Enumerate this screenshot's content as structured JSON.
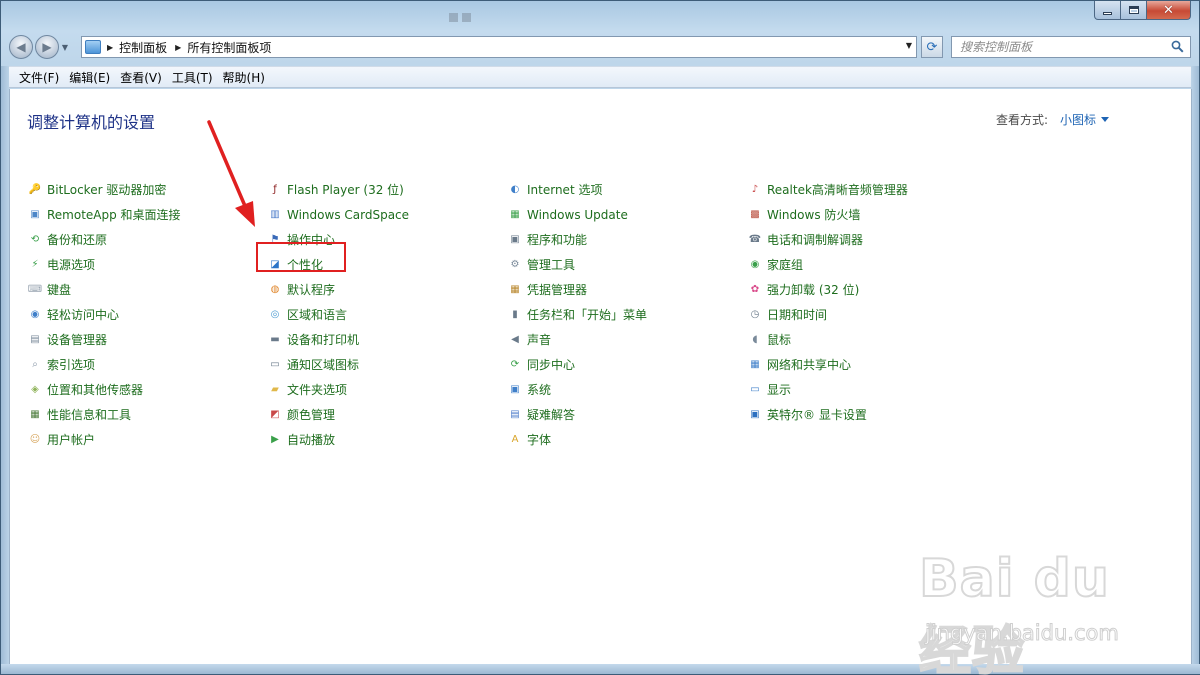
{
  "window": {
    "minimize": "—",
    "maximize": "□",
    "close": "✕"
  },
  "address": {
    "crumbs": [
      "控制面板",
      "所有控制面板项"
    ]
  },
  "search": {
    "placeholder": "搜索控制面板"
  },
  "menu": [
    "文件(F)",
    "编辑(E)",
    "查看(V)",
    "工具(T)",
    "帮助(H)"
  ],
  "content": {
    "heading": "调整计算机的设置",
    "view_by_label": "查看方式:",
    "view_by_value": "小图标"
  },
  "columns": [
    [
      {
        "label": "BitLocker 驱动器加密",
        "icon": "bitlocker-icon"
      },
      {
        "label": "RemoteApp 和桌面连接",
        "icon": "remoteapp-icon"
      },
      {
        "label": "备份和还原",
        "icon": "backup-icon"
      },
      {
        "label": "电源选项",
        "icon": "power-icon"
      },
      {
        "label": "键盘",
        "icon": "keyboard-icon"
      },
      {
        "label": "轻松访问中心",
        "icon": "ease-of-access-icon"
      },
      {
        "label": "设备管理器",
        "icon": "device-manager-icon"
      },
      {
        "label": "索引选项",
        "icon": "indexing-icon"
      },
      {
        "label": "位置和其他传感器",
        "icon": "sensor-icon"
      },
      {
        "label": "性能信息和工具",
        "icon": "performance-icon"
      },
      {
        "label": "用户帐户",
        "icon": "user-accounts-icon"
      }
    ],
    [
      {
        "label": "Flash Player (32 位)",
        "icon": "flash-icon"
      },
      {
        "label": "Windows CardSpace",
        "icon": "cardspace-icon"
      },
      {
        "label": "操作中心",
        "icon": "flag-icon"
      },
      {
        "label": "个性化",
        "icon": "personalization-icon"
      },
      {
        "label": "默认程序",
        "icon": "default-programs-icon"
      },
      {
        "label": "区域和语言",
        "icon": "region-icon"
      },
      {
        "label": "设备和打印机",
        "icon": "printer-icon"
      },
      {
        "label": "通知区域图标",
        "icon": "notification-icon"
      },
      {
        "label": "文件夹选项",
        "icon": "folder-options-icon"
      },
      {
        "label": "颜色管理",
        "icon": "color-management-icon"
      },
      {
        "label": "自动播放",
        "icon": "autoplay-icon"
      }
    ],
    [
      {
        "label": "Internet 选项",
        "icon": "internet-options-icon"
      },
      {
        "label": "Windows Update",
        "icon": "windows-update-icon"
      },
      {
        "label": "程序和功能",
        "icon": "programs-icon"
      },
      {
        "label": "管理工具",
        "icon": "admin-tools-icon"
      },
      {
        "label": "凭据管理器",
        "icon": "credential-icon"
      },
      {
        "label": "任务栏和「开始」菜单",
        "icon": "taskbar-icon"
      },
      {
        "label": "声音",
        "icon": "sound-icon"
      },
      {
        "label": "同步中心",
        "icon": "sync-icon"
      },
      {
        "label": "系统",
        "icon": "system-icon"
      },
      {
        "label": "疑难解答",
        "icon": "troubleshoot-icon"
      },
      {
        "label": "字体",
        "icon": "fonts-icon"
      }
    ],
    [
      {
        "label": "Realtek高清晰音频管理器",
        "icon": "realtek-icon"
      },
      {
        "label": "Windows 防火墙",
        "icon": "firewall-icon"
      },
      {
        "label": "电话和调制解调器",
        "icon": "phone-modem-icon"
      },
      {
        "label": "家庭组",
        "icon": "homegroup-icon"
      },
      {
        "label": "强力卸载 (32 位)",
        "icon": "uninstall-icon"
      },
      {
        "label": "日期和时间",
        "icon": "date-time-icon"
      },
      {
        "label": "鼠标",
        "icon": "mouse-icon"
      },
      {
        "label": "网络和共享中心",
        "icon": "network-icon"
      },
      {
        "label": "显示",
        "icon": "display-icon"
      },
      {
        "label": "英特尔® 显卡设置",
        "icon": "intel-graphics-icon"
      }
    ]
  ],
  "watermark": {
    "brand": "Bai du 经验",
    "url": "jingyan.baidu.com"
  },
  "colors": {
    "link": "#1e6d1e",
    "heading": "#1e3287",
    "highlight": "#e02020",
    "arrow": "#e02020"
  }
}
